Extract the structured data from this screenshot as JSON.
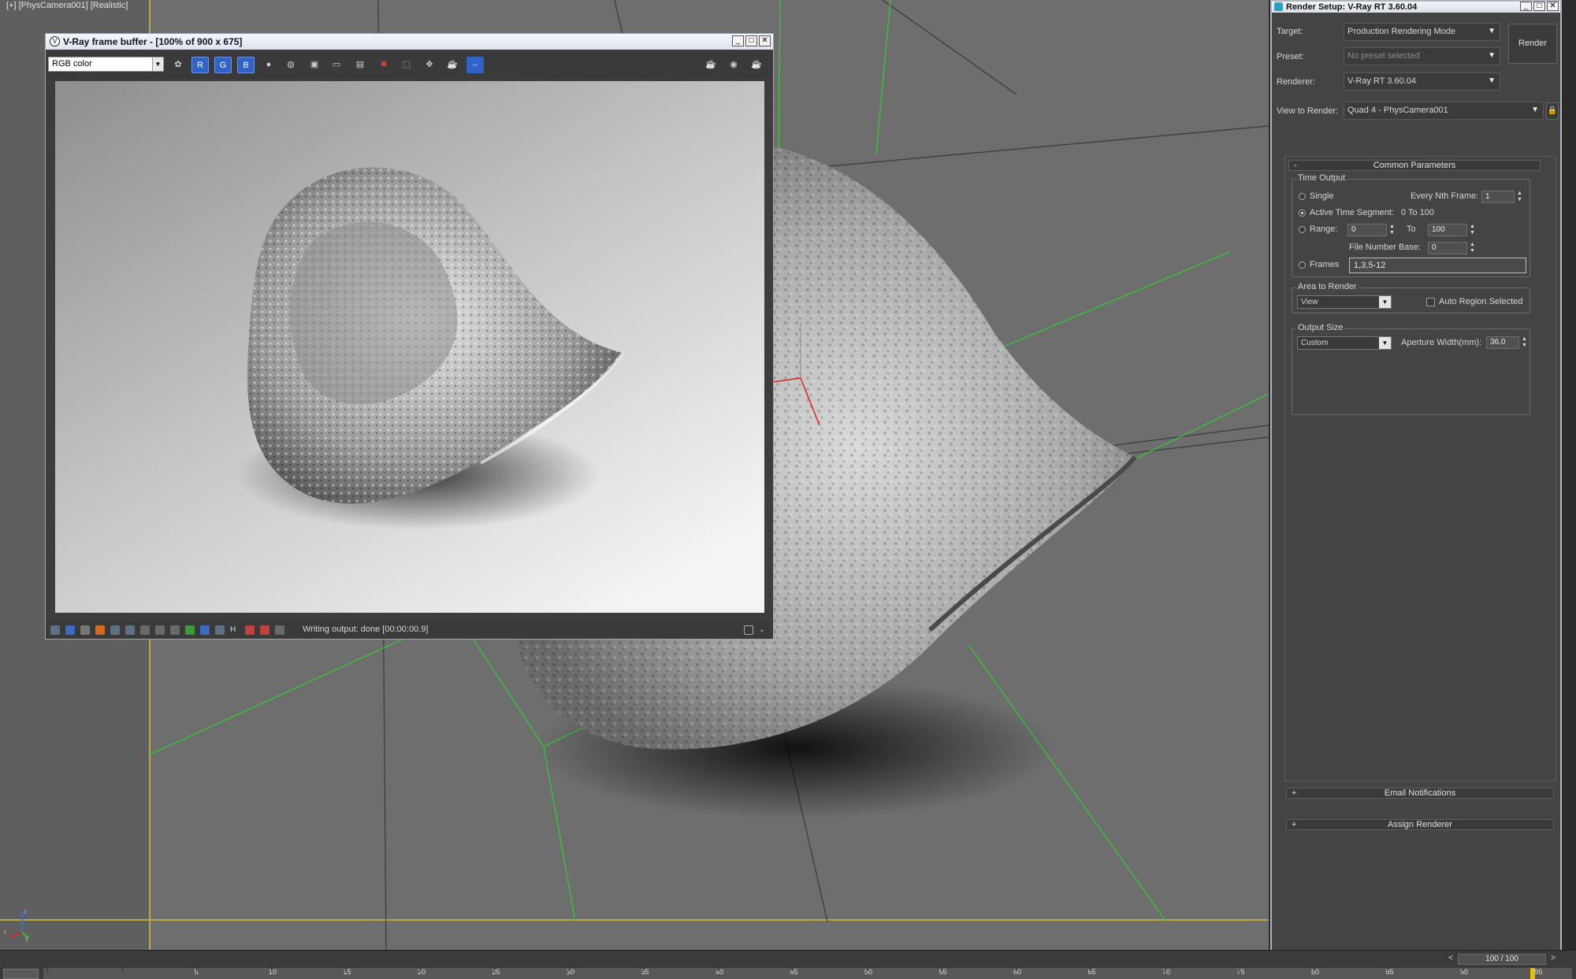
{
  "viewport": {
    "label": "[+] [PhysCamera001] [Realistic]",
    "gizmo_x": "x",
    "gizmo_y": "y",
    "gizmo_z": "z"
  },
  "frame_buffer": {
    "title": "V-Ray frame buffer - [100% of 900 x 675]",
    "channel": "RGB color",
    "channel_buttons": [
      "R",
      "G",
      "B"
    ],
    "status": "Writing output: done [00:00:00.9]"
  },
  "render_setup": {
    "title": "Render Setup: V-Ray RT 3.60.04",
    "target_label": "Target:",
    "target_value": "Production Rendering Mode",
    "preset_label": "Preset:",
    "preset_value": "No preset selected",
    "renderer_label": "Renderer:",
    "renderer_value": "V-Ray RT 3.60.04",
    "view_label": "View to Render:",
    "view_value": "Quad 4 - PhysCamera001",
    "render_button": "Render",
    "common_parameters": "Common Parameters",
    "time_output": {
      "title": "Time Output",
      "single": "Single",
      "every_nth_label": "Every Nth Frame:",
      "every_nth_value": "1",
      "active_segment": "Active Time Segment:",
      "active_segment_range": "0 To 100",
      "range": "Range:",
      "range_from": "0",
      "range_to_label": "To",
      "range_to": "100",
      "file_number_base_label": "File Number Base:",
      "file_number_base": "0",
      "frames": "Frames",
      "frames_value": "1,3,5-12"
    },
    "area_to_render": {
      "title": "Area to Render",
      "value": "View",
      "auto_region": "Auto Region Selected"
    },
    "output_size": {
      "title": "Output Size",
      "value": "Custom",
      "aperture_label": "Aperture Width(mm):",
      "aperture_value": "36.0"
    },
    "email_notifications": "Email Notifications",
    "assign_renderer": "Assign Renderer"
  },
  "timeline": {
    "slider": "100 / 100",
    "prev": "<",
    "next": ">",
    "ticks": [
      "0",
      "5",
      "10",
      "15",
      "20",
      "25",
      "30",
      "35",
      "40",
      "45",
      "50",
      "55",
      "60",
      "65",
      "70",
      "75",
      "80",
      "85",
      "90",
      "95"
    ]
  }
}
